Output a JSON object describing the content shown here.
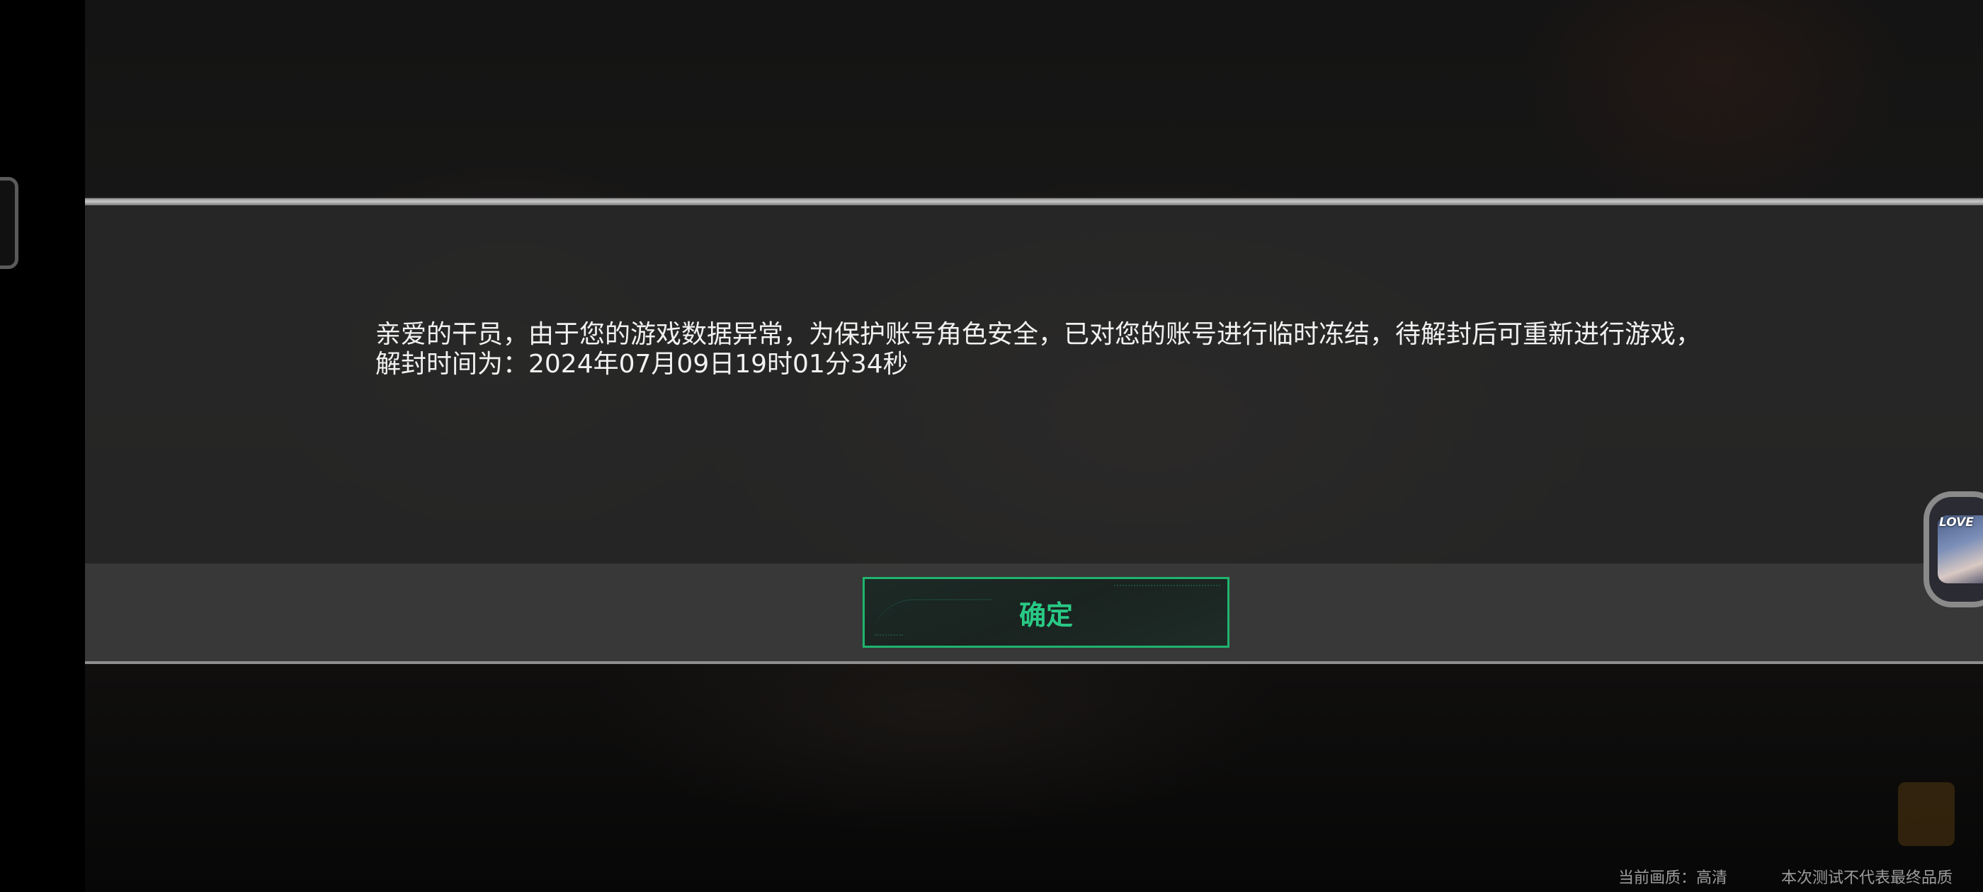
{
  "dialog": {
    "message": "亲爱的干员，由于您的游戏数据异常，为保护账号角色安全，已对您的账号进行临时冻结，待解封后可重新进行游戏，",
    "unban_time": "解封时间为：2024年07月09日19时01分34秒",
    "confirm_label": "确定"
  },
  "floating_avatar": {
    "label": "LOVE"
  },
  "status": {
    "quality": "当前画质：高清",
    "disclaimer": "本次测试不代表最终品质"
  },
  "colors": {
    "accent": "#29c985",
    "button_border": "#1fb46e",
    "text": "#f1f1f1"
  }
}
